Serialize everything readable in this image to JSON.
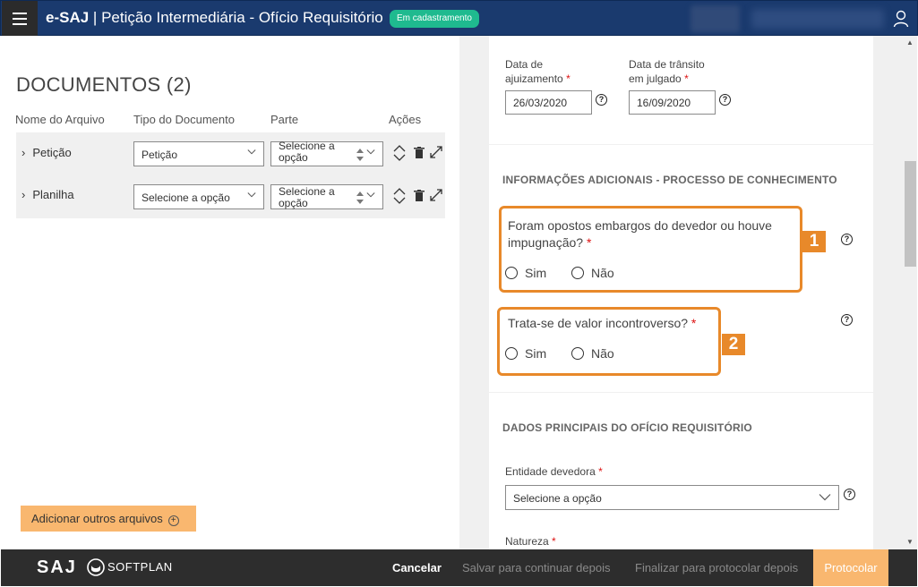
{
  "header": {
    "brand": "e-SAJ",
    "separator": "|",
    "title": "Petição Intermediária - Ofício Requisitório",
    "status": "Em cadastramento"
  },
  "documents": {
    "title": "DOCUMENTOS (2)",
    "columns": [
      "Nome do Arquivo",
      "Tipo do Documento",
      "Parte",
      "Ações"
    ],
    "rows": [
      {
        "name": "Petição",
        "type": "Petição",
        "party": "Selecione a opção"
      },
      {
        "name": "Planilha",
        "type": "Selecione a opção",
        "party": "Selecione a opção"
      }
    ],
    "add_button": "Adicionar outros arquivos"
  },
  "form": {
    "date_filing_label": "Data de ajuizamento",
    "date_filing_value": "26/03/2020",
    "date_final_label": "Data de trânsito em julgado",
    "date_final_value": "16/09/2020",
    "section_additional": "INFORMAÇÕES ADICIONAIS - PROCESSO DE CONHECIMENTO",
    "q1": "Foram opostos embargos do devedor ou houve impugnação?",
    "q2": "Trata-se de valor incontroverso?",
    "yes": "Sim",
    "no": "Não",
    "badge1": "1",
    "badge2": "2",
    "section_main": "DADOS PRINCIPAIS DO OFÍCIO REQUISITÓRIO",
    "entity_label": "Entidade devedora",
    "entity_value": "Selecione a opção",
    "nature_label": "Natureza",
    "required_mark": "*",
    "help": "?"
  },
  "footer": {
    "logo_saj": "SAJ",
    "logo_softplan": "SOFTPLAN",
    "cancel": "Cancelar",
    "save": "Salvar para continuar depois",
    "finish": "Finalizar para protocolar depois",
    "protocol": "Protocolar"
  },
  "colors": {
    "header_bg": "#1a3a6e",
    "status_green": "#1fba8f",
    "highlight_orange": "#e8892a",
    "button_orange": "#f9b76f",
    "footer_bg": "#2d2d2d"
  }
}
